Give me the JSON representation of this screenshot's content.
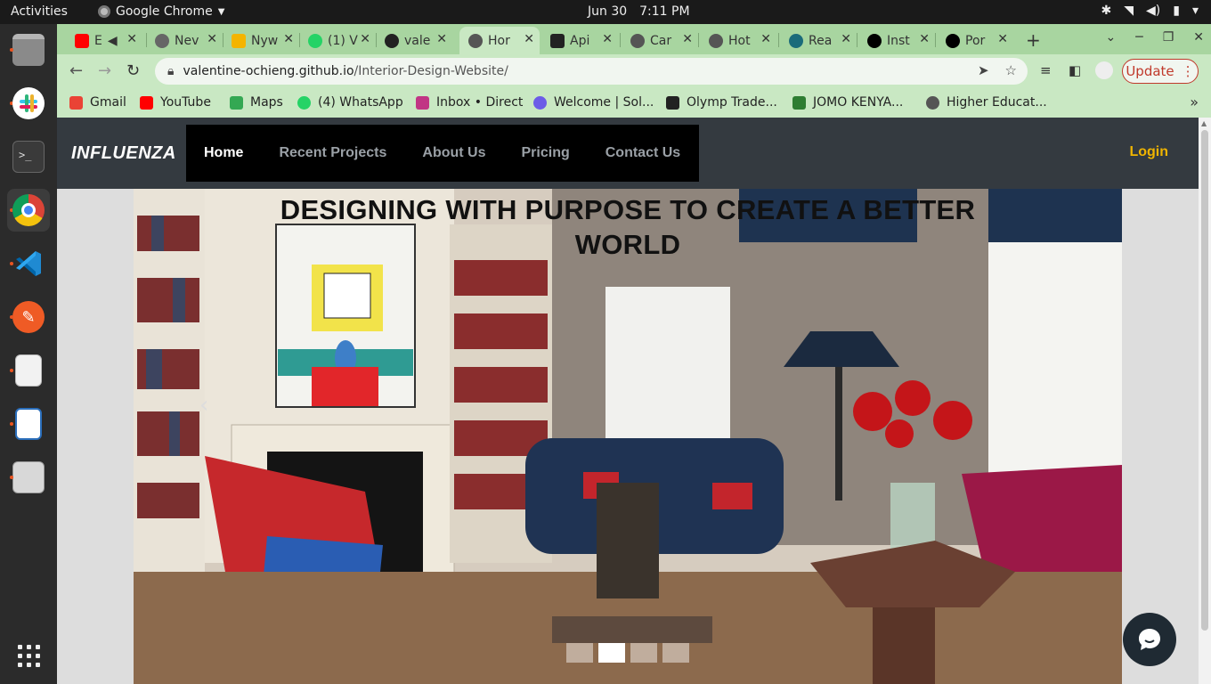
{
  "system_bar": {
    "activities": "Activities",
    "app_name": "Google Chrome",
    "date": "Jun 30",
    "time": "7:11 PM"
  },
  "dock": {
    "items": [
      "files-icon",
      "slack-icon",
      "terminal-icon",
      "chrome-icon",
      "vscode-icon",
      "postman-icon",
      "document-viewer-icon",
      "writer-icon",
      "image-viewer-icon",
      "app-grid-icon"
    ]
  },
  "browser": {
    "tabs": [
      {
        "label": "E",
        "icon": "youtube-icon"
      },
      {
        "label": "Nev",
        "icon": "globe-icon"
      },
      {
        "label": "Nyw",
        "icon": "slides-icon"
      },
      {
        "label": "(1) V",
        "icon": "whatsapp-icon"
      },
      {
        "label": "vale",
        "icon": "github-icon"
      },
      {
        "label": "Hor",
        "icon": "globe-icon",
        "active": true
      },
      {
        "label": "Api",
        "icon": "angular-icon"
      },
      {
        "label": "Car",
        "icon": "globe-icon"
      },
      {
        "label": "Hot",
        "icon": "globe-icon"
      },
      {
        "label": "Rea",
        "icon": "react-icon"
      },
      {
        "label": "Inst",
        "icon": "vercel-icon"
      },
      {
        "label": "Por",
        "icon": "vercel-icon"
      }
    ],
    "address": {
      "domain": "valentine-ochieng.github.io",
      "path": "/Interior-Design-Website/"
    },
    "update_label": "Update",
    "bookmarks": [
      {
        "label": "Gmail",
        "icon": "gmail-icon",
        "color": "#ea4335"
      },
      {
        "label": "YouTube",
        "icon": "youtube-icon",
        "color": "#ff0000"
      },
      {
        "label": "Maps",
        "icon": "maps-icon",
        "color": "#34a853"
      },
      {
        "label": "(4) WhatsApp",
        "icon": "whatsapp-icon",
        "color": "#25d366"
      },
      {
        "label": "Inbox • Direct",
        "icon": "instagram-icon",
        "color": "#c13584"
      },
      {
        "label": "Welcome | Sol...",
        "icon": "sololearn-icon",
        "color": "#6c5ce7"
      },
      {
        "label": "Olymp Trade...",
        "icon": "olymp-icon",
        "color": "#222222"
      },
      {
        "label": "JOMO KENYA...",
        "icon": "jkuat-icon",
        "color": "#2e7d32"
      },
      {
        "label": "Higher Educat...",
        "icon": "helb-icon",
        "color": "#555555"
      }
    ]
  },
  "site": {
    "brand": "INFLUENZA",
    "menu": [
      {
        "label": "Home",
        "active": true
      },
      {
        "label": "Recent Projects"
      },
      {
        "label": "About Us"
      },
      {
        "label": "Pricing"
      },
      {
        "label": "Contact Us"
      }
    ],
    "login": "Login",
    "hero": {
      "title": "DESIGNING WITH PURPOSE TO CREATE A BETTER WORLD",
      "slides": 4,
      "active_slide": 2
    }
  },
  "colors": {
    "chrome_frame": "#a8d5a0",
    "nav_bg": "#343a40",
    "login": "#f0b400",
    "update": "#c0392b"
  }
}
